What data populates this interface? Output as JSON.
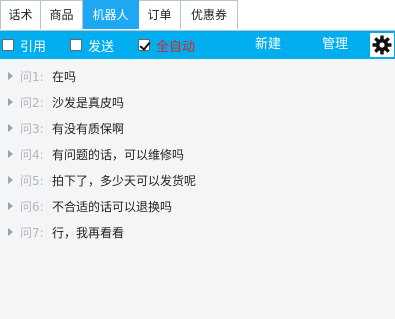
{
  "tabs": [
    {
      "label": "话术",
      "active": false
    },
    {
      "label": "商品",
      "active": false
    },
    {
      "label": "机器人",
      "active": true
    },
    {
      "label": "订单",
      "active": false
    },
    {
      "label": "优惠券",
      "active": false
    }
  ],
  "toolbar": {
    "quote_label": "引用",
    "quote_checked": false,
    "send_label": "发送",
    "send_checked": false,
    "auto_label": "全自动",
    "auto_checked": true,
    "new_label": "新建",
    "manage_label": "管理",
    "settings_icon": "gear-icon"
  },
  "colors": {
    "accent": "#00aeef",
    "active_tab": "#1ea7f2",
    "auto_label": "#e02020"
  },
  "questions": [
    {
      "label": "问1:",
      "text": "在吗"
    },
    {
      "label": "问2:",
      "text": "沙发是真皮吗"
    },
    {
      "label": "问3:",
      "text": "有没有质保啊"
    },
    {
      "label": "问4:",
      "text": "有问题的话，可以维修吗"
    },
    {
      "label": "问5:",
      "text": "拍下了，多少天可以发货呢"
    },
    {
      "label": "问6:",
      "text": "不合适的话可以退换吗"
    },
    {
      "label": "问7:",
      "text": "行，我再看看"
    }
  ]
}
